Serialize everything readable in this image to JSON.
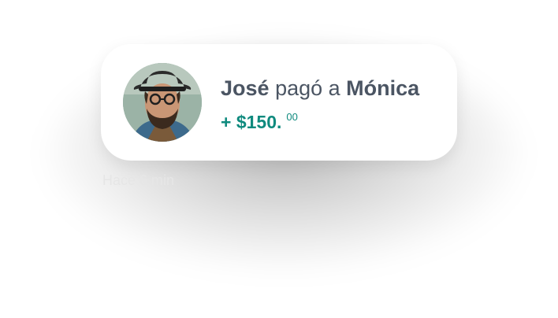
{
  "notification": {
    "payer": "José",
    "verb": "pagó a",
    "payee": "Mónica",
    "amount_main": "+ $150.",
    "amount_cents": "00",
    "timestamp": "Hace 6 min",
    "avatar_icon": "user-photo-avatar",
    "accent_color": "#0f8a7e",
    "text_color": "#4b5563"
  }
}
